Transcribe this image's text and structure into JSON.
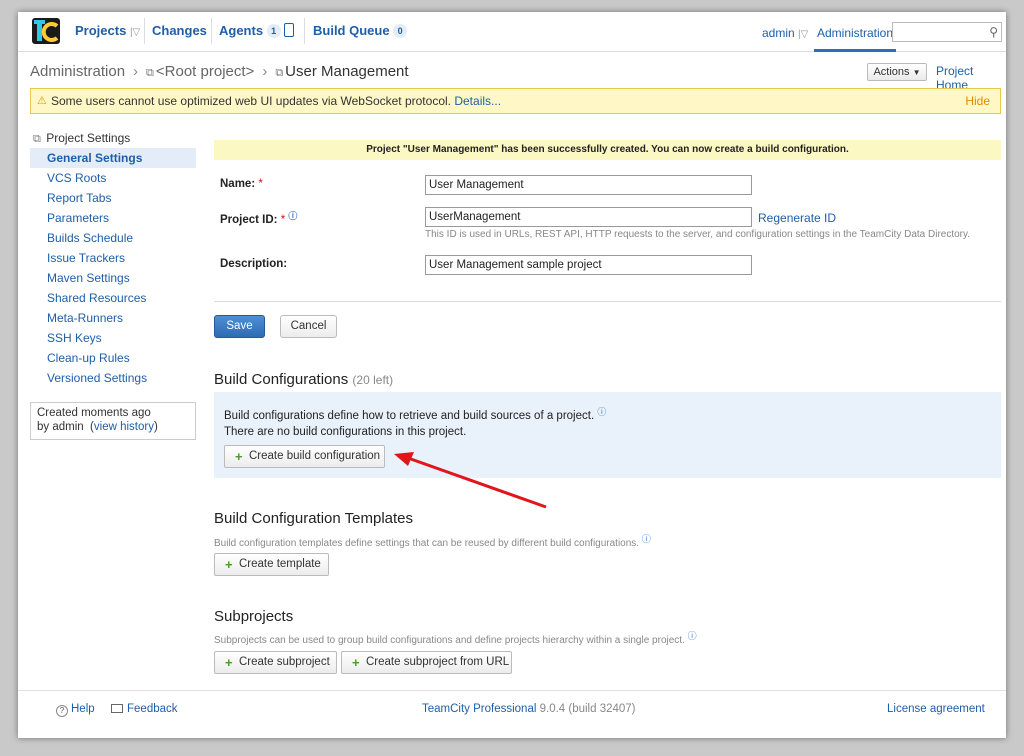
{
  "nav": {
    "projects": "Projects",
    "changes": "Changes",
    "agents": "Agents",
    "agents_count": "1",
    "build_queue": "Build Queue",
    "build_queue_count": "0",
    "user": "admin",
    "administration": "Administration",
    "search_placeholder": ""
  },
  "breadcrumb": {
    "items": [
      "Administration",
      "<Root project>",
      "User Management"
    ]
  },
  "header_actions": {
    "actions_label": "Actions",
    "project_home": "Project Home"
  },
  "warning": {
    "message": "Some users cannot use optimized web UI updates via WebSocket protocol.",
    "details_link": "Details...",
    "hide": "Hide"
  },
  "sidebar": {
    "title": "Project Settings",
    "items": [
      "General Settings",
      "VCS Roots",
      "Report Tabs",
      "Parameters",
      "Builds Schedule",
      "Issue Trackers",
      "Maven Settings",
      "Shared Resources",
      "Meta-Runners",
      "SSH Keys",
      "Clean-up Rules",
      "Versioned Settings"
    ],
    "active_index": 0,
    "created_text": "Created moments ago",
    "created_by": "by admin",
    "view_history": "view history"
  },
  "notice": "Project \"User Management\" has been successfully created. You can now create a build configuration.",
  "form": {
    "name_label": "Name:",
    "name_value": "User Management",
    "project_id_label": "Project ID:",
    "project_id_value": "UserManagement",
    "regenerate_id": "Regenerate ID",
    "project_id_hint": "This ID is used in URLs, REST API, HTTP requests to the server, and configuration settings in the TeamCity Data Directory.",
    "description_label": "Description:",
    "description_value": "User Management sample project",
    "save": "Save",
    "cancel": "Cancel"
  },
  "build_configurations": {
    "title": "Build Configurations",
    "left": "(20 left)",
    "description": "Build configurations define how to retrieve and build sources of a project.",
    "empty": "There are no build configurations in this project.",
    "create_button": "Create build configuration"
  },
  "templates": {
    "title": "Build Configuration Templates",
    "description": "Build configuration templates define settings that can be reused by different build configurations.",
    "create_button": "Create template"
  },
  "subprojects": {
    "title": "Subprojects",
    "description": "Subprojects can be used to group build configurations and define projects hierarchy within a single project.",
    "create_button": "Create subproject",
    "create_from_url_button": "Create subproject from URL"
  },
  "footer": {
    "help": "Help",
    "feedback": "Feedback",
    "product": "TeamCity Professional",
    "version": "9.0.4 (build 32407)",
    "license": "License agreement"
  },
  "colors": {
    "accent": "#1f5ea8",
    "arrow": "#e0161b",
    "warning_bg": "#fff8c6",
    "panel_bg": "#e9f1fa"
  }
}
